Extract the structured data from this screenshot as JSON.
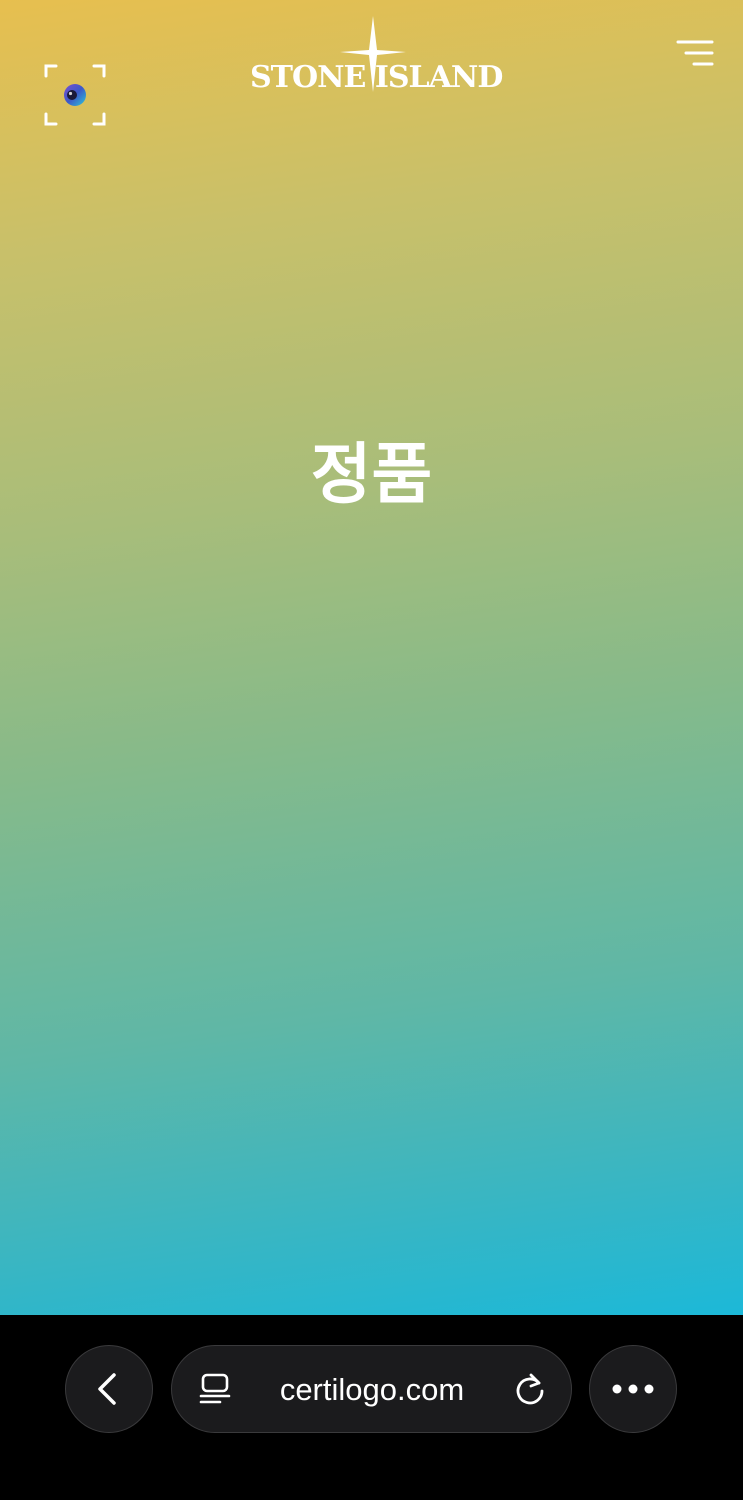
{
  "header": {
    "brand_name": "STONE ISLAND",
    "scan_icon": "scan-frame-icon",
    "menu_icon": "menu-icon"
  },
  "main": {
    "status_text": "정품"
  },
  "browser": {
    "url": "certilogo.com",
    "back_icon": "chevron-left-icon",
    "reader_icon": "page-format-icon",
    "reload_icon": "reload-icon",
    "more_icon": "ellipsis-icon"
  },
  "colors": {
    "gradient_top": "#e7bf4f",
    "gradient_bottom": "#1cb8d8",
    "toolbar_background": "#000000",
    "button_background": "#1b1b1d"
  }
}
